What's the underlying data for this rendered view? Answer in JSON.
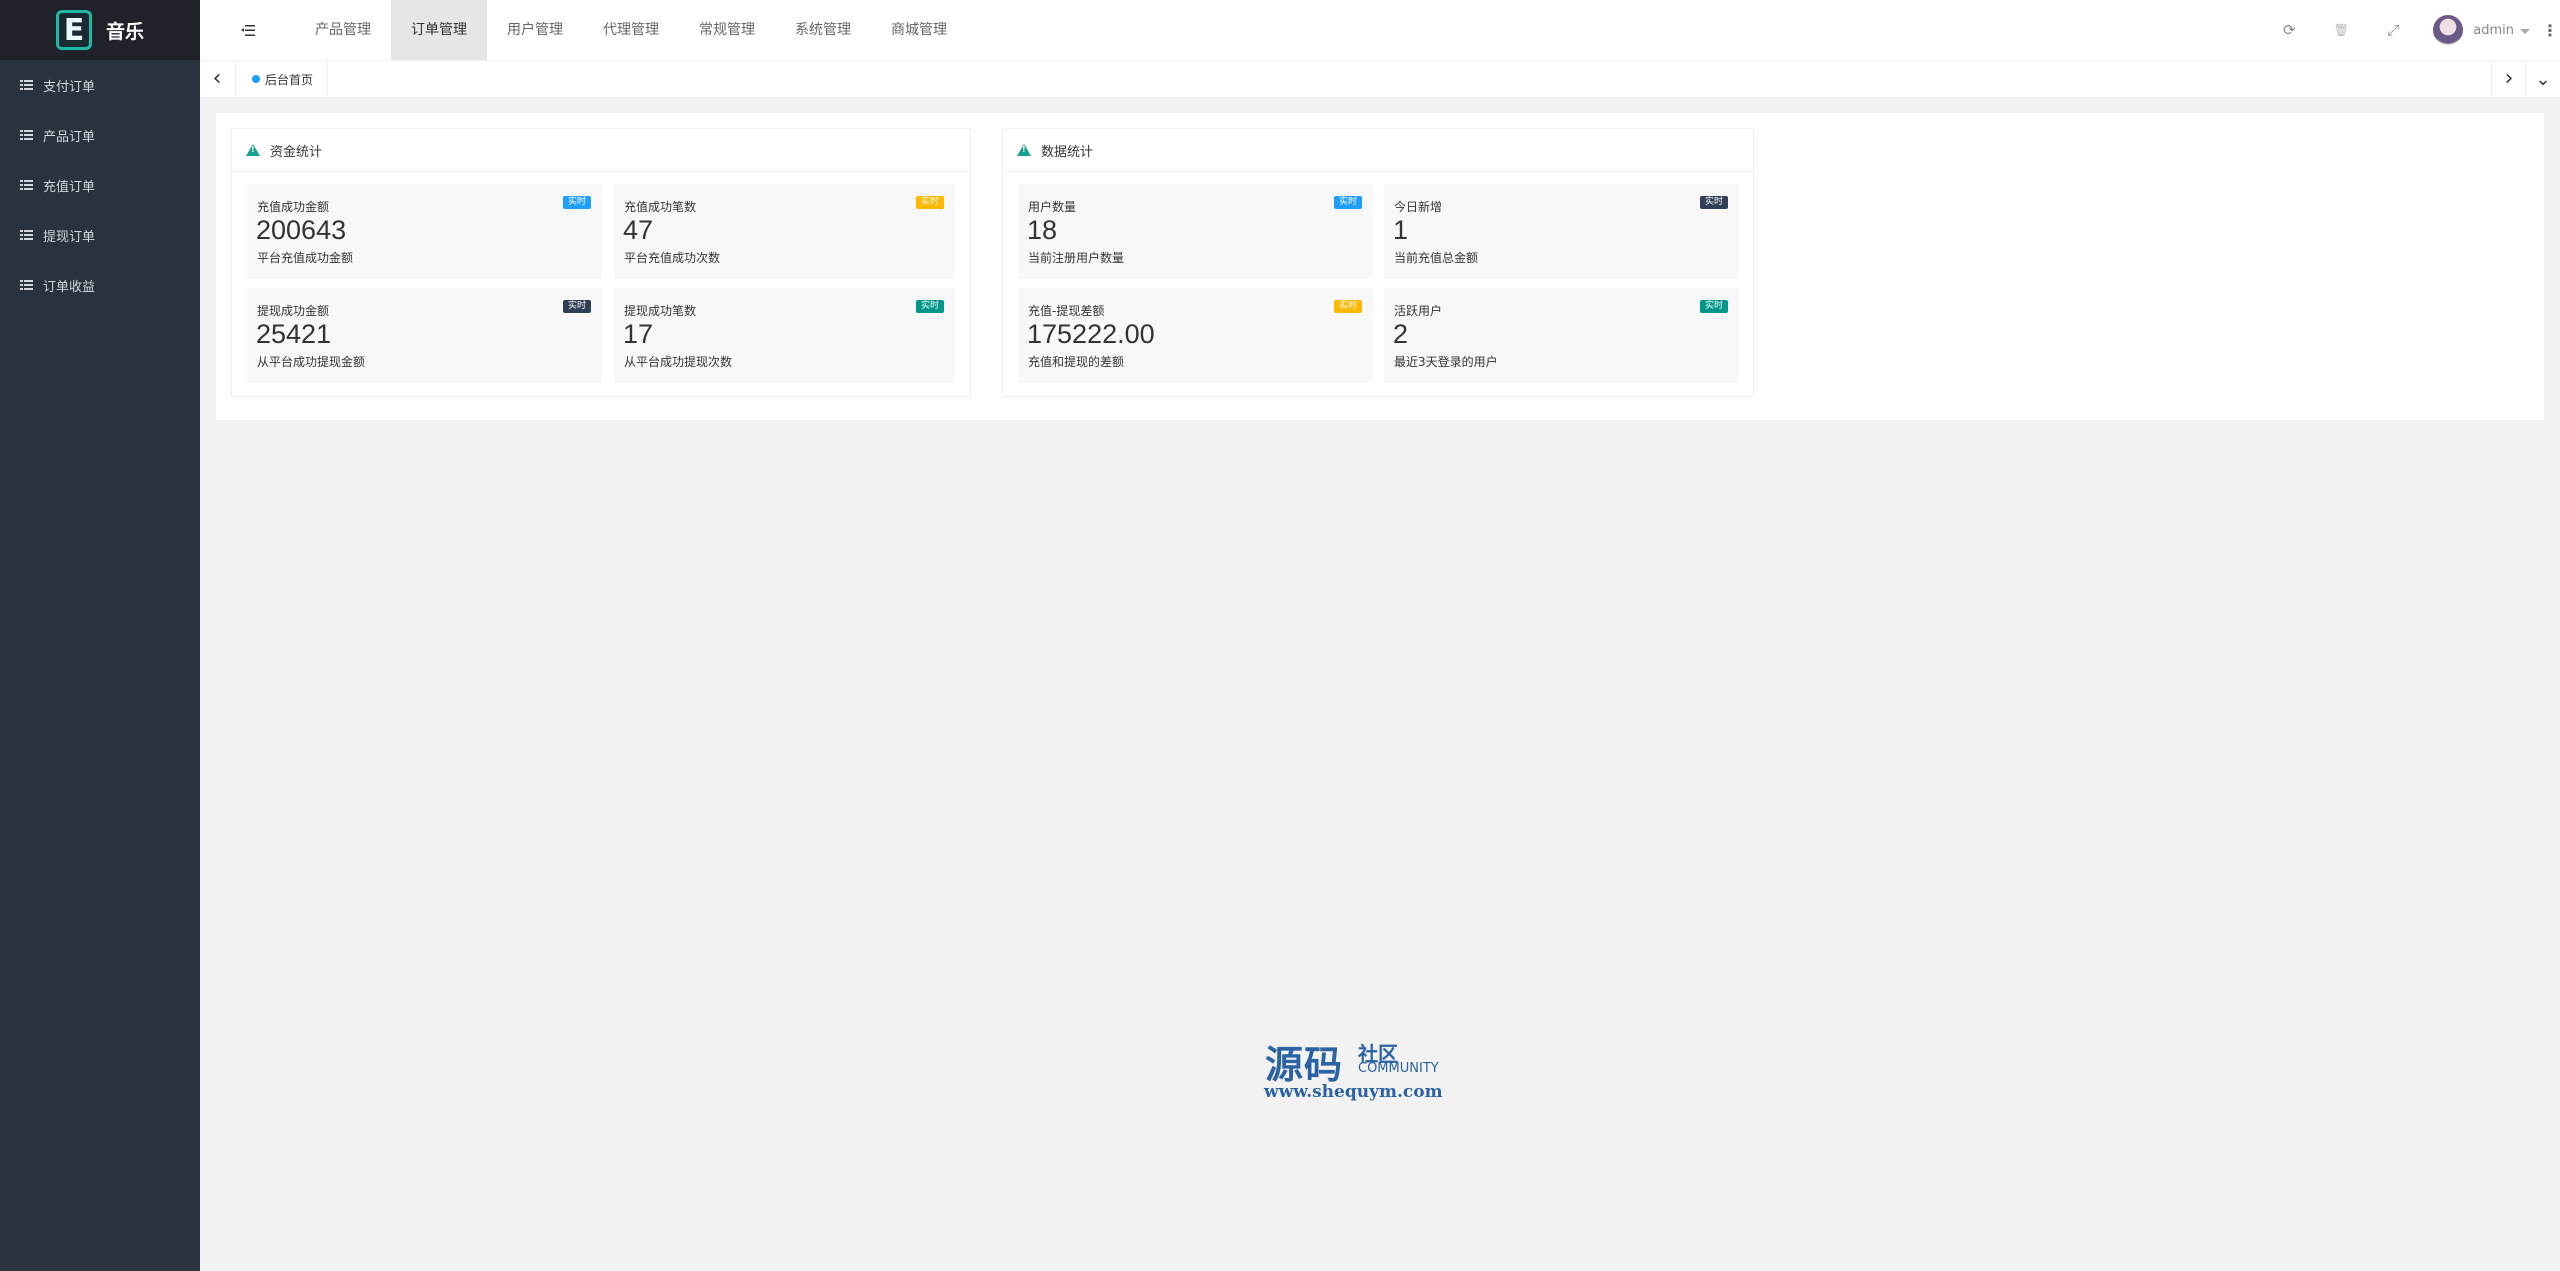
{
  "app": {
    "logo_letter": "E",
    "title": "音乐"
  },
  "sidebar": {
    "items": [
      {
        "label": "支付订单"
      },
      {
        "label": "产品订单"
      },
      {
        "label": "充值订单"
      },
      {
        "label": "提现订单"
      },
      {
        "label": "订单收益"
      }
    ]
  },
  "header": {
    "tabs": [
      {
        "label": "产品管理"
      },
      {
        "label": "订单管理",
        "active": true
      },
      {
        "label": "用户管理"
      },
      {
        "label": "代理管理"
      },
      {
        "label": "常规管理"
      },
      {
        "label": "系统管理"
      },
      {
        "label": "商城管理"
      }
    ],
    "user": {
      "name": "admin"
    },
    "tools": {
      "refresh": "⟳",
      "clear": "🗑",
      "fullscreen": "⤢",
      "more": "⋮"
    }
  },
  "tabsbar": {
    "home_tab": "后台首页",
    "prev": "‹",
    "next": "›",
    "dropdown": "⌄"
  },
  "panels": [
    {
      "title": "资金统计",
      "cells": [
        {
          "label": "充值成功金额",
          "value": "200643",
          "desc": "平台充值成功金额",
          "badge": "实时",
          "badge_color": "#1e9fff"
        },
        {
          "label": "充值成功笔数",
          "value": "47",
          "desc": "平台充值成功次数",
          "badge": "实时",
          "badge_color": "#ffb800"
        },
        {
          "label": "提现成功金额",
          "value": "25421",
          "desc": "从平台成功提现金额",
          "badge": "实时",
          "badge_color": "#2f4056"
        },
        {
          "label": "提现成功笔数",
          "value": "17",
          "desc": "从平台成功提现次数",
          "badge": "实时",
          "badge_color": "#009688"
        }
      ]
    },
    {
      "title": "数据统计",
      "cells": [
        {
          "label": "用户数量",
          "value": "18",
          "desc": "当前注册用户数量",
          "badge": "实时",
          "badge_color": "#1e9fff"
        },
        {
          "label": "今日新增",
          "value": "1",
          "desc": "当前充值总金额",
          "badge": "实时",
          "badge_color": "#2f4056"
        },
        {
          "label": "充值-提现差额",
          "value": "175222.00",
          "desc": "充值和提现的差额",
          "badge": "实时",
          "badge_color": "#ffb800"
        },
        {
          "label": "活跃用户",
          "value": "2",
          "desc": "最近3天登录的用户",
          "badge": "实时",
          "badge_color": "#009688"
        }
      ]
    }
  ],
  "watermark": {
    "big": "源码",
    "small": "社区",
    "community": "COMMUNITY",
    "url": "www.shequym.com"
  }
}
